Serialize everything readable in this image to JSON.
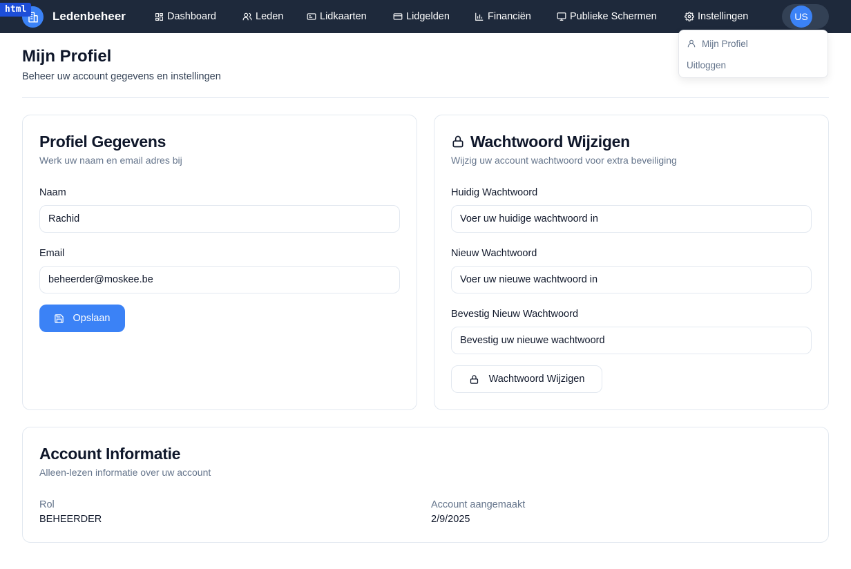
{
  "badge": "html",
  "brand": {
    "name": "Ledenbeheer",
    "logo_icon": "building-icon"
  },
  "nav": {
    "items": [
      {
        "label": "Dashboard",
        "icon": "dashboard-icon"
      },
      {
        "label": "Leden",
        "icon": "users-icon"
      },
      {
        "label": "Lidkaarten",
        "icon": "id-card-icon"
      },
      {
        "label": "Lidgelden",
        "icon": "credit-card-icon"
      },
      {
        "label": "Financiën",
        "icon": "bar-chart-icon"
      },
      {
        "label": "Publieke Schermen",
        "icon": "monitor-icon"
      },
      {
        "label": "Instellingen",
        "icon": "gear-icon"
      }
    ],
    "user_initials": "US"
  },
  "user_menu": {
    "profile_label": "Mijn Profiel",
    "logout_label": "Uitloggen"
  },
  "page": {
    "title": "Mijn Profiel",
    "subtitle": "Beheer uw account gegevens en instellingen"
  },
  "profile_card": {
    "title": "Profiel Gegevens",
    "description": "Werk uw naam en email adres bij",
    "name_label": "Naam",
    "name_value": "Rachid",
    "email_label": "Email",
    "email_value": "beheerder@moskee.be",
    "save_label": "Opslaan"
  },
  "password_card": {
    "title": "Wachtwoord Wijzigen",
    "description": "Wijzig uw account wachtwoord voor extra beveiliging",
    "current_label": "Huidig Wachtwoord",
    "current_placeholder": "Voer uw huidige wachtwoord in",
    "new_label": "Nieuw Wachtwoord",
    "new_placeholder": "Voer uw nieuwe wachtwoord in",
    "confirm_label": "Bevestig Nieuw Wachtwoord",
    "confirm_placeholder": "Bevestig uw nieuwe wachtwoord",
    "submit_label": "Wachtwoord Wijzigen"
  },
  "account_card": {
    "title": "Account Informatie",
    "description": "Alleen-lezen informatie over uw account",
    "role_label": "Rol",
    "role_value": "BEHEERDER",
    "created_label": "Account aangemaakt",
    "created_value": "2/9/2025"
  },
  "colors": {
    "navbar": "#1e293b",
    "primary": "#3b82f6",
    "muted_text": "#64748b",
    "border": "#e2e8f0"
  }
}
